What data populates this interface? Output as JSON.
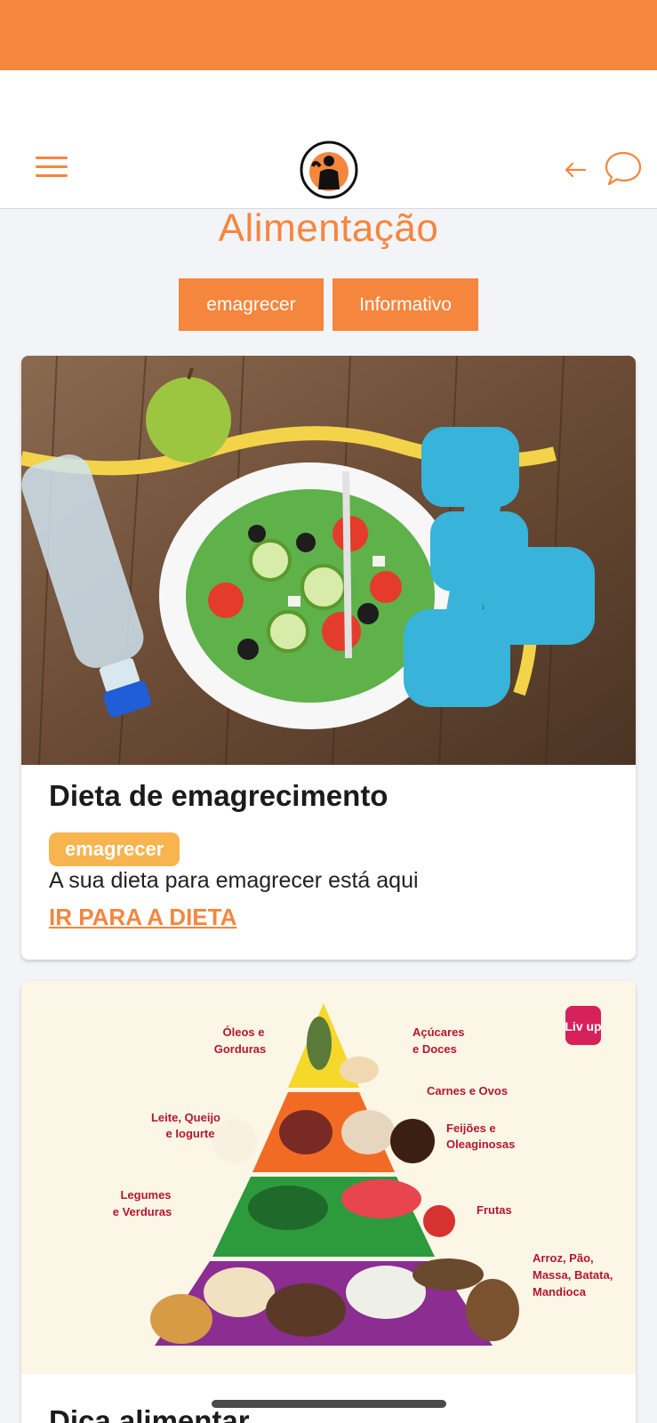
{
  "header": {
    "logo_icon": "gym-logo-icon",
    "menu_icon": "hamburger-menu-icon",
    "back_icon": "arrow-left-icon",
    "chat_icon": "chat-bubble-icon",
    "accent_color": "#f5863e"
  },
  "page": {
    "title": "Alimentação",
    "filters": [
      "emagrecer",
      "Informativo"
    ]
  },
  "cards": [
    {
      "title": "Dieta de emagrecimento",
      "tag": "emagrecer",
      "description": "A sua dieta para emagrecer está aqui",
      "link": "IR PARA A DIETA"
    },
    {
      "title": "Dica alimentar",
      "pyramid": {
        "brand": "Liv up",
        "labels": {
          "oleos": "Óleos e",
          "oleos2": "Gorduras",
          "acucares": "Açúcares",
          "acucares2": "e Doces",
          "carnes": "Carnes e Ovos",
          "leite": "Leite, Queijo",
          "leite2": "e Iogurte",
          "feijoes": "Feijões e",
          "feijoes2": "Oleaginosas",
          "legumes": "Legumes",
          "legumes2": "e Verduras",
          "frutas": "Frutas",
          "arroz": "Arroz, Pão,",
          "arroz2": "Massa, Batata,",
          "arroz3": "Mandioca"
        }
      }
    }
  ],
  "colors": {
    "tag": "#f7b44f",
    "pyramid_bg": "#fcf6e6"
  }
}
